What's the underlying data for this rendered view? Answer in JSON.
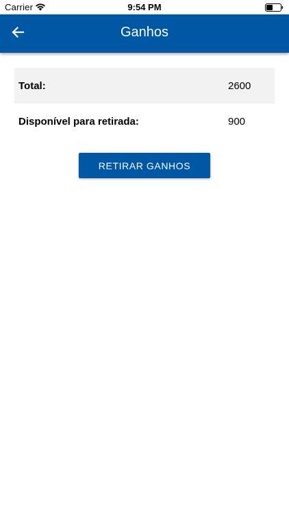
{
  "status_bar": {
    "carrier": "Carrier",
    "time": "9:54 PM",
    "wifi_icon": "wifi-icon",
    "battery_icon": "battery-icon",
    "battery_level": 0.4
  },
  "header": {
    "title": "Ganhos",
    "back_icon": "arrow-left-icon",
    "background_color": "#0057a3"
  },
  "earnings": {
    "rows": [
      {
        "label": "Total:",
        "value": "2600"
      },
      {
        "label": "Disponível para retirada:",
        "value": "900"
      }
    ]
  },
  "actions": {
    "withdraw_label": "RETIRAR GANHOS",
    "button_color": "#0057a3"
  }
}
